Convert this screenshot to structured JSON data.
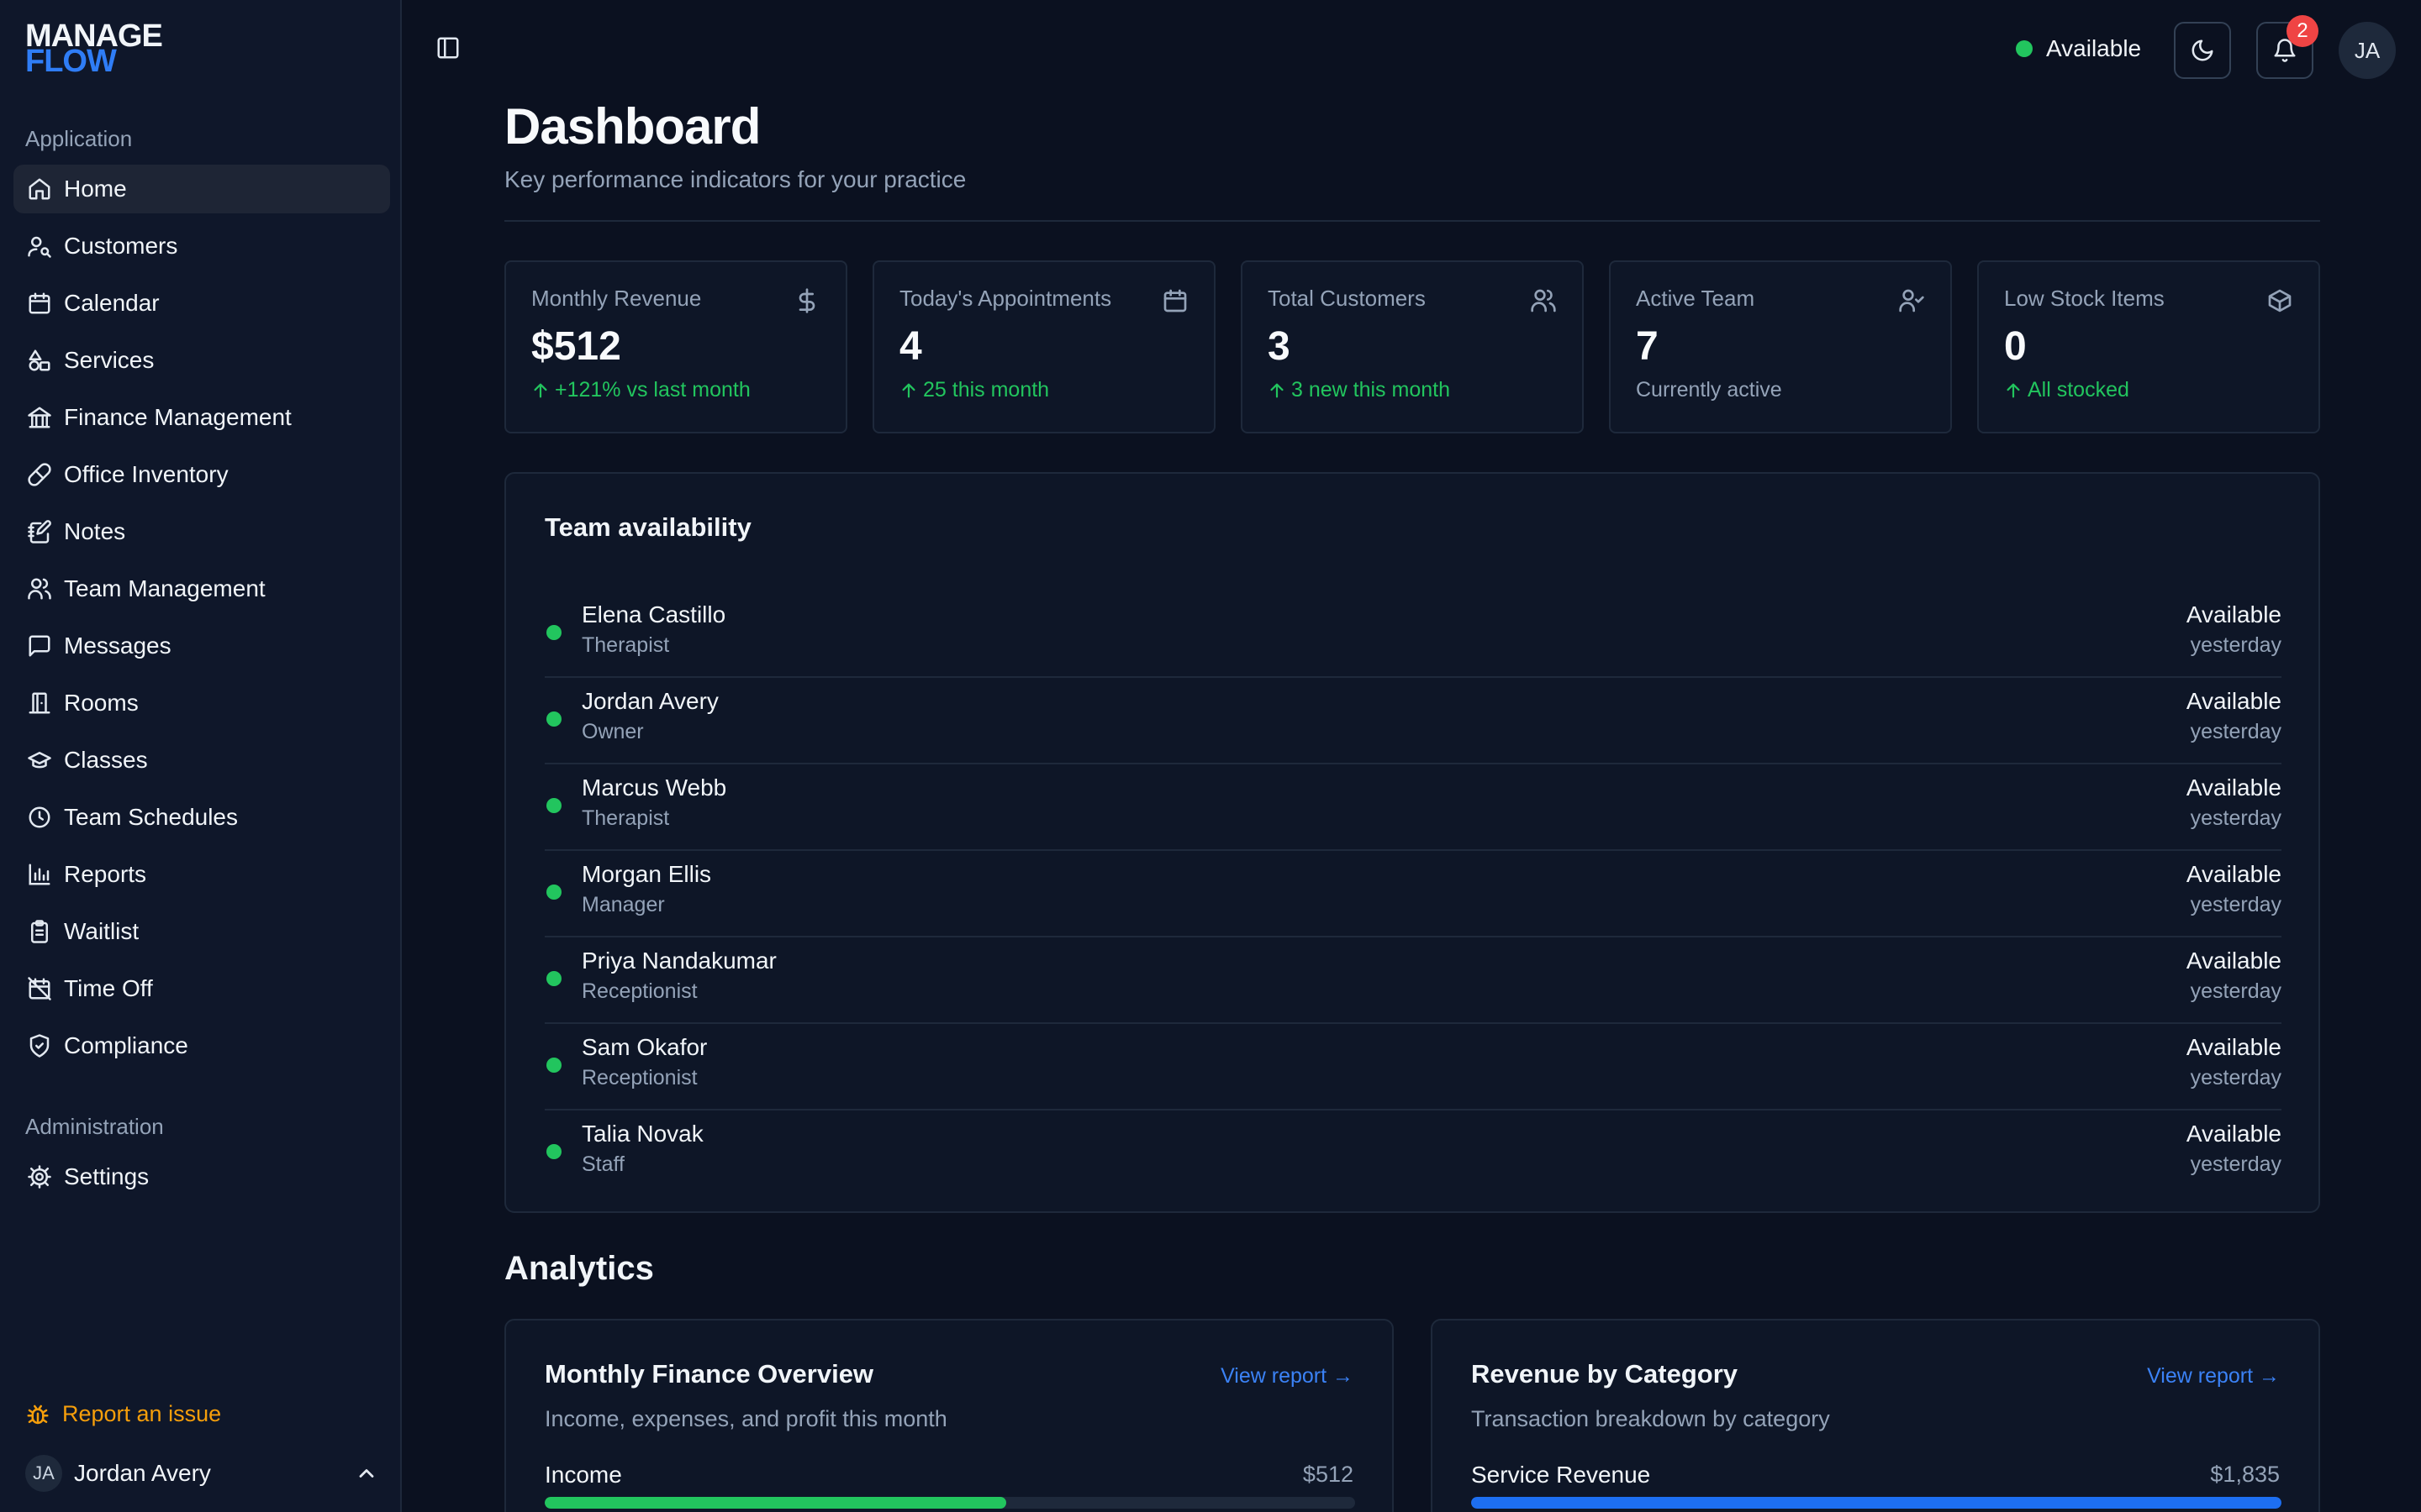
{
  "app": {
    "logo_line1": "MANAGE",
    "logo_line2": "FLOW"
  },
  "sidebar": {
    "section_application": "Application",
    "items": [
      {
        "label": "Home",
        "icon": "home-icon",
        "active": true
      },
      {
        "label": "Customers",
        "icon": "user-search-icon"
      },
      {
        "label": "Calendar",
        "icon": "calendar-icon"
      },
      {
        "label": "Services",
        "icon": "shapes-icon"
      },
      {
        "label": "Finance Management",
        "icon": "landmark-icon"
      },
      {
        "label": "Office Inventory",
        "icon": "pill-icon"
      },
      {
        "label": "Notes",
        "icon": "notebook-pen-icon"
      },
      {
        "label": "Team Management",
        "icon": "users-icon"
      },
      {
        "label": "Messages",
        "icon": "message-square-icon"
      },
      {
        "label": "Rooms",
        "icon": "door-icon"
      },
      {
        "label": "Classes",
        "icon": "graduation-cap-icon"
      },
      {
        "label": "Team Schedules",
        "icon": "clock-icon"
      },
      {
        "label": "Reports",
        "icon": "bar-chart-icon"
      },
      {
        "label": "Waitlist",
        "icon": "clipboard-list-icon"
      },
      {
        "label": "Time Off",
        "icon": "calendar-off-icon"
      },
      {
        "label": "Compliance",
        "icon": "shield-check-icon"
      }
    ],
    "section_admin": "Administration",
    "admin_items": [
      {
        "label": "Settings",
        "icon": "gear-icon"
      }
    ],
    "report_issue": "Report an issue",
    "user_initials": "JA",
    "user_name": "Jordan Avery"
  },
  "topbar": {
    "status_label": "Available",
    "status_color": "#22c55e",
    "notification_count": "2",
    "avatar_initials": "JA"
  },
  "header": {
    "title": "Dashboard",
    "subtitle": "Key performance indicators for your practice"
  },
  "kpis": [
    {
      "title": "Monthly Revenue",
      "value": "$512",
      "delta": "+121% vs last month",
      "icon": "dollar-icon",
      "trend": "up"
    },
    {
      "title": "Today's Appointments",
      "value": "4",
      "delta": "25 this month",
      "icon": "calendar-icon",
      "trend": "up"
    },
    {
      "title": "Total Customers",
      "value": "3",
      "delta": "3 new this month",
      "icon": "users-icon",
      "trend": "up"
    },
    {
      "title": "Active Team",
      "value": "7",
      "delta": "Currently active",
      "icon": "user-check-icon",
      "trend": "none"
    },
    {
      "title": "Low Stock Items",
      "value": "0",
      "delta": "All stocked",
      "icon": "package-icon",
      "trend": "up"
    }
  ],
  "team": {
    "title": "Team availability",
    "members": [
      {
        "name": "Elena Castillo",
        "role": "Therapist",
        "status": "Available",
        "time": "yesterday"
      },
      {
        "name": "Jordan Avery",
        "role": "Owner",
        "status": "Available",
        "time": "yesterday"
      },
      {
        "name": "Marcus Webb",
        "role": "Therapist",
        "status": "Available",
        "time": "yesterday"
      },
      {
        "name": "Morgan Ellis",
        "role": "Manager",
        "status": "Available",
        "time": "yesterday"
      },
      {
        "name": "Priya Nandakumar",
        "role": "Receptionist",
        "status": "Available",
        "time": "yesterday"
      },
      {
        "name": "Sam Okafor",
        "role": "Receptionist",
        "status": "Available",
        "time": "yesterday"
      },
      {
        "name": "Talia Novak",
        "role": "Staff",
        "status": "Available",
        "time": "yesterday"
      }
    ]
  },
  "analytics": {
    "title": "Analytics",
    "cards": [
      {
        "title": "Monthly Finance Overview",
        "link": "View report →",
        "subtitle": "Income, expenses, and profit this month",
        "row_label": "Income",
        "row_value": "$512",
        "fill_fraction": 0.57,
        "fill_color": "#22c55e"
      },
      {
        "title": "Revenue by Category",
        "link": "View report →",
        "subtitle": "Transaction breakdown by category",
        "row_label": "Service Revenue",
        "row_value": "$1,835",
        "fill_fraction": 1.0,
        "fill_color": "#1d6ff2"
      }
    ]
  }
}
